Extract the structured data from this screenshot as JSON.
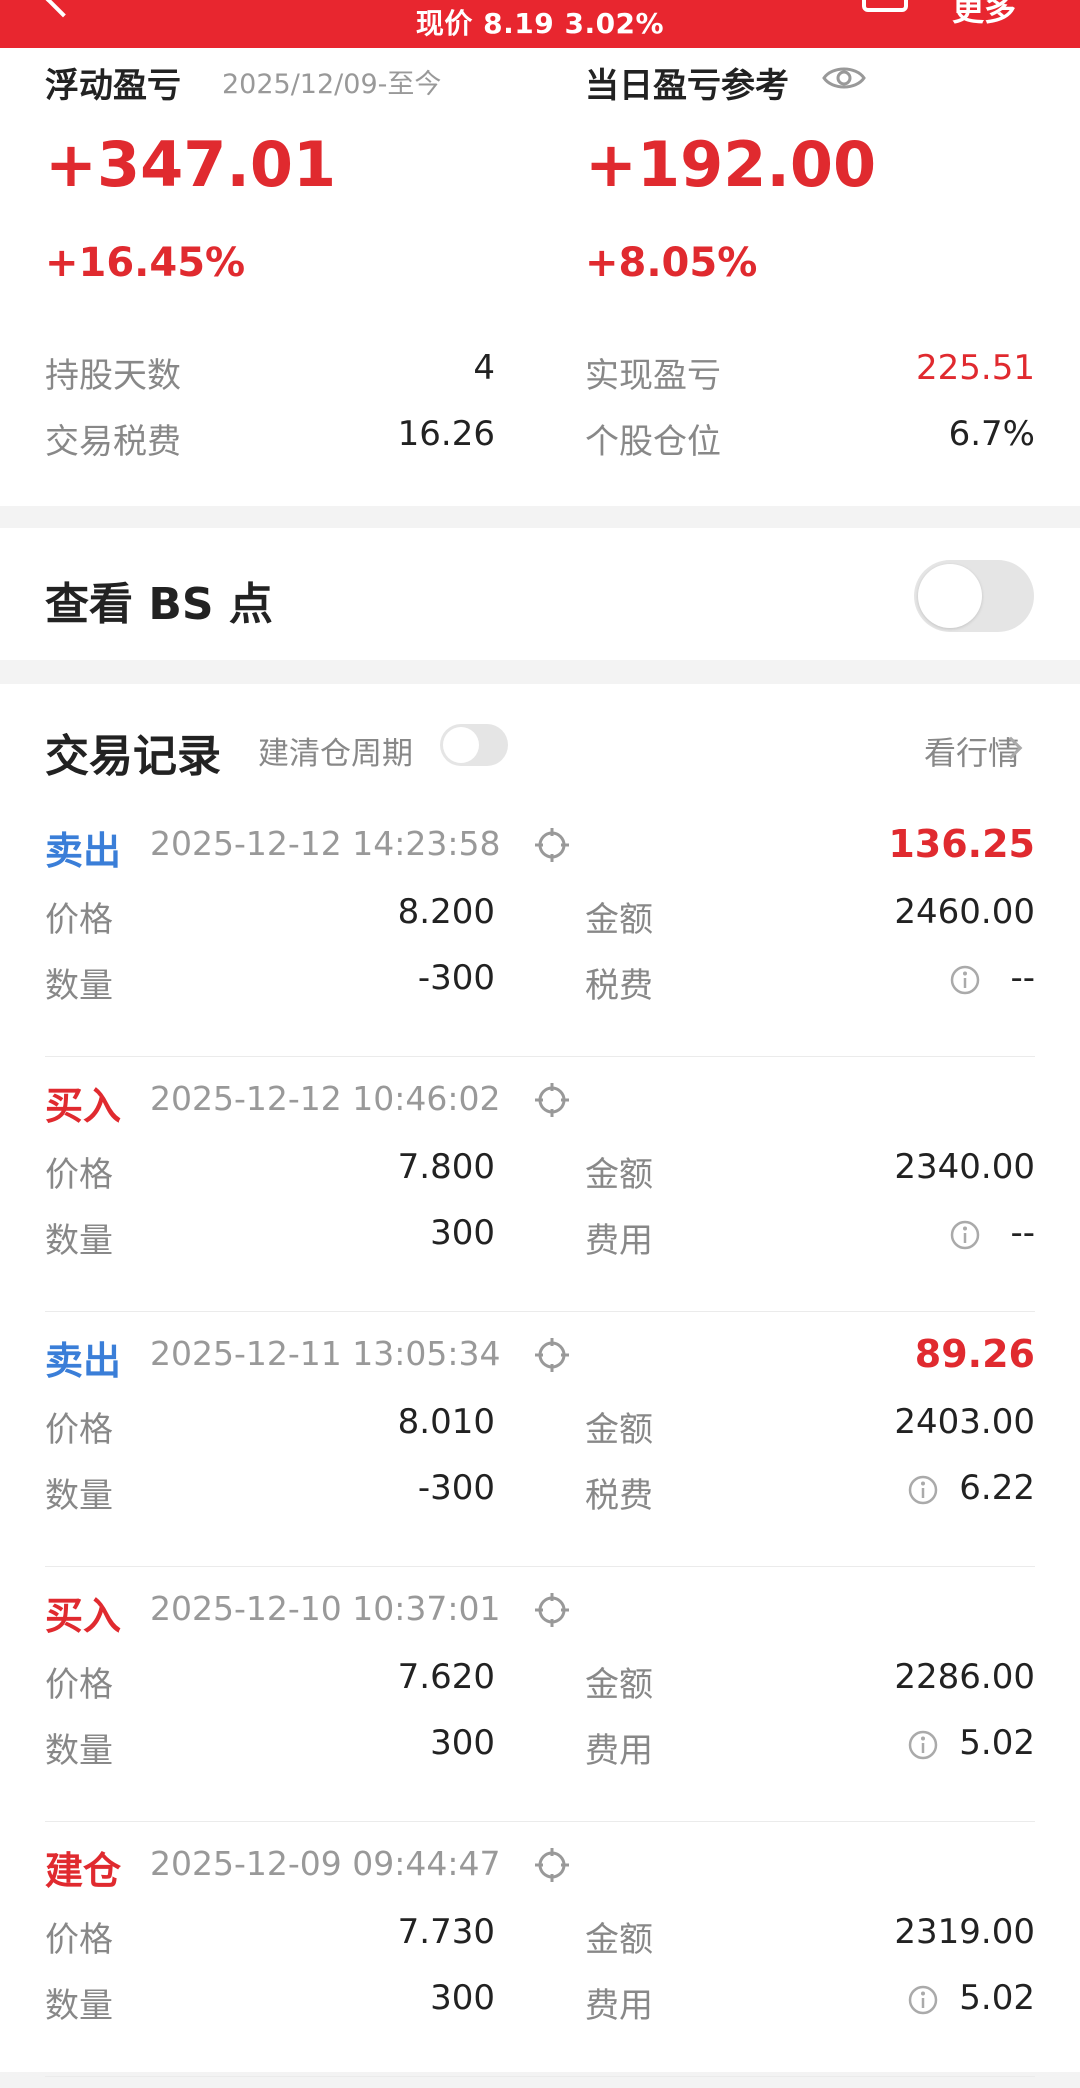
{
  "header": {
    "current_price_text": "现价 8.19 3.02%",
    "more_label": "更多"
  },
  "summary": {
    "floating_label": "浮动盈亏",
    "floating_since": "2025/12/09-至今",
    "floating_value": "+347.01",
    "floating_pct": "+16.45%",
    "daily_label": "当日盈亏参考",
    "daily_value": "+192.00",
    "daily_pct": "+8.05%",
    "stats": {
      "hold_days_label": "持股天数",
      "hold_days_value": "4",
      "fees_label": "交易税费",
      "fees_value": "16.26",
      "realized_label": "实现盈亏",
      "realized_value": "225.51",
      "position_label": "个股仓位",
      "position_value": "6.7%"
    }
  },
  "bs": {
    "label": "查看 BS 点",
    "enabled": false
  },
  "records": {
    "title": "交易记录",
    "cycle_label": "建清仓周期",
    "cycle_enabled": false,
    "market_link": "看行情",
    "trades": [
      {
        "type": "卖出",
        "kind": "sell",
        "time": "2025-12-12 14:23:58",
        "profit": "136.25",
        "price_label": "价格",
        "price": "8.200",
        "amount_label": "金额",
        "amount": "2460.00",
        "qty_label": "数量",
        "qty": "-300",
        "fee_label": "税费",
        "fee": "--"
      },
      {
        "type": "买入",
        "kind": "buy",
        "time": "2025-12-12 10:46:02",
        "profit": "",
        "price_label": "价格",
        "price": "7.800",
        "amount_label": "金额",
        "amount": "2340.00",
        "qty_label": "数量",
        "qty": "300",
        "fee_label": "费用",
        "fee": "--"
      },
      {
        "type": "卖出",
        "kind": "sell",
        "time": "2025-12-11 13:05:34",
        "profit": "89.26",
        "price_label": "价格",
        "price": "8.010",
        "amount_label": "金额",
        "amount": "2403.00",
        "qty_label": "数量",
        "qty": "-300",
        "fee_label": "税费",
        "fee": "6.22"
      },
      {
        "type": "买入",
        "kind": "buy",
        "time": "2025-12-10 10:37:01",
        "profit": "",
        "price_label": "价格",
        "price": "7.620",
        "amount_label": "金额",
        "amount": "2286.00",
        "qty_label": "数量",
        "qty": "300",
        "fee_label": "费用",
        "fee": "5.02"
      },
      {
        "type": "建仓",
        "kind": "buy",
        "time": "2025-12-09 09:44:47",
        "profit": "",
        "price_label": "价格",
        "price": "7.730",
        "amount_label": "金额",
        "amount": "2319.00",
        "qty_label": "数量",
        "qty": "300",
        "fee_label": "费用",
        "fee": "5.02"
      }
    ]
  },
  "colors": {
    "accent_red": "#e02a2f",
    "sell_blue": "#3a7ed8",
    "header_red": "#e8262f"
  },
  "icons": {
    "back": "chevron-left-icon",
    "share": "share-icon",
    "eye": "eye-icon",
    "target": "target-icon",
    "info": "info-icon",
    "chevron": "chevron-right-icon"
  }
}
